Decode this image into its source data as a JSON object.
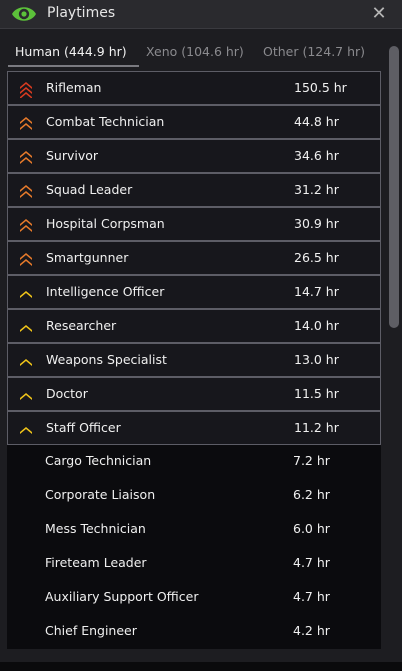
{
  "window": {
    "title": "Playtimes",
    "close_glyph": "✕",
    "eye_icon_color": "#5cc13a"
  },
  "tabs": [
    {
      "label": "Human (444.9 hr)",
      "active": true
    },
    {
      "label": "Xeno (104.6 hr)",
      "active": false
    },
    {
      "label": "Other (124.7 hr)",
      "active": false
    }
  ],
  "roles": [
    {
      "name": "Rifleman",
      "hours": "150.5 hr",
      "rank_icon": "red-chevron-stack-icon",
      "rank_color": "#d93b20"
    },
    {
      "name": "Combat Technician",
      "hours": "44.8 hr",
      "rank_icon": "orange-chevron-stack-icon",
      "rank_color": "#e67a2a"
    },
    {
      "name": "Survivor",
      "hours": "34.6 hr",
      "rank_icon": "orange-chevron-stack-icon",
      "rank_color": "#e67a2a"
    },
    {
      "name": "Squad Leader",
      "hours": "31.2 hr",
      "rank_icon": "orange-chevron-stack-icon",
      "rank_color": "#e67a2a"
    },
    {
      "name": "Hospital Corpsman",
      "hours": "30.9 hr",
      "rank_icon": "orange-chevron-stack-icon",
      "rank_color": "#e67a2a"
    },
    {
      "name": "Smartgunner",
      "hours": "26.5 hr",
      "rank_icon": "orange-chevron-stack-icon",
      "rank_color": "#e67a2a"
    },
    {
      "name": "Intelligence Officer",
      "hours": "14.7 hr",
      "rank_icon": "gold-chevron-icon",
      "rank_color": "#f0c419"
    },
    {
      "name": "Researcher",
      "hours": "14.0 hr",
      "rank_icon": "gold-chevron-icon",
      "rank_color": "#f0c419"
    },
    {
      "name": "Weapons Specialist",
      "hours": "13.0 hr",
      "rank_icon": "gold-chevron-icon",
      "rank_color": "#f0c419"
    },
    {
      "name": "Doctor",
      "hours": "11.5 hr",
      "rank_icon": "gold-chevron-icon",
      "rank_color": "#f0c419"
    },
    {
      "name": "Staff Officer",
      "hours": "11.2 hr",
      "rank_icon": "gold-chevron-icon",
      "rank_color": "#f0c419"
    },
    {
      "name": "Cargo Technician",
      "hours": "7.2 hr",
      "rank_icon": null
    },
    {
      "name": "Corporate Liaison",
      "hours": "6.2 hr",
      "rank_icon": null
    },
    {
      "name": "Mess Technician",
      "hours": "6.0 hr",
      "rank_icon": null
    },
    {
      "name": "Fireteam Leader",
      "hours": "4.7 hr",
      "rank_icon": null
    },
    {
      "name": "Auxiliary Support Officer",
      "hours": "4.7 hr",
      "rank_icon": null
    },
    {
      "name": "Chief Engineer",
      "hours": "4.2 hr",
      "rank_icon": null
    }
  ]
}
